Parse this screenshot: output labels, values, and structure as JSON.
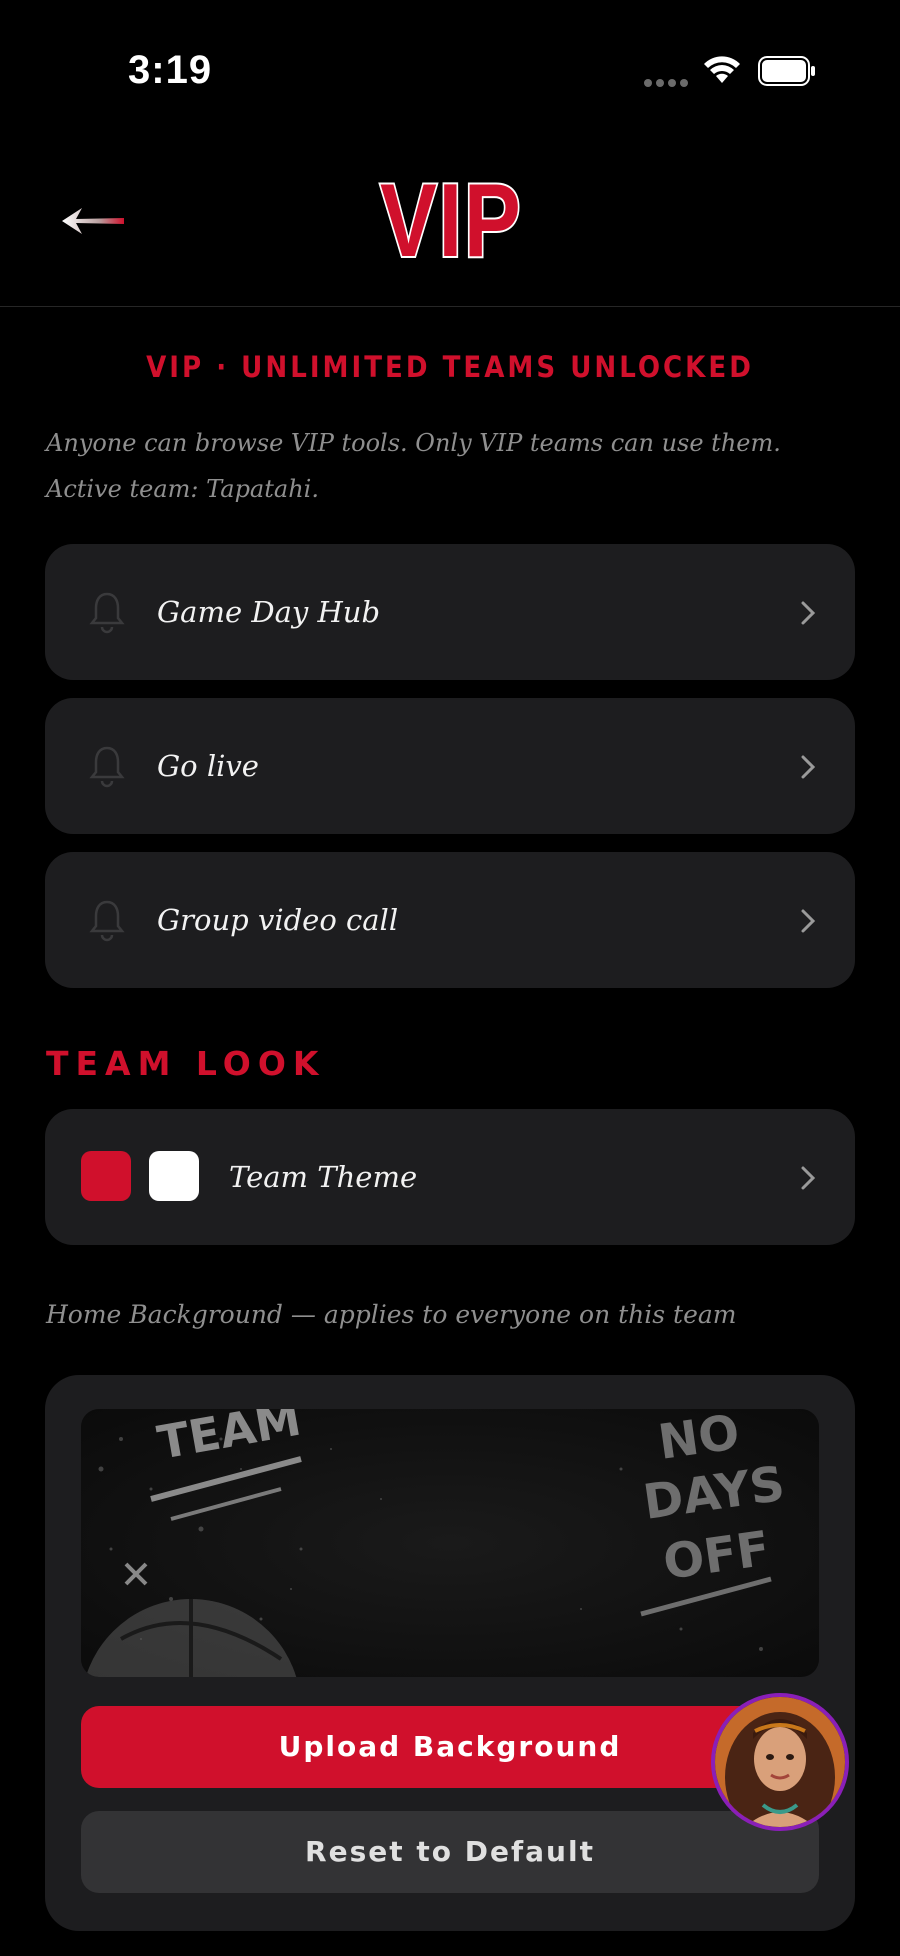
{
  "status_bar": {
    "time": "3:19"
  },
  "header": {
    "title": "VIP"
  },
  "vip_status": "VIP · UNLIMITED TEAMS UNLOCKED",
  "intro_text": "Anyone can browse VIP tools. Only VIP teams can use them. Active team: Tapatahi.",
  "tools": [
    {
      "label": "Game Day Hub",
      "icon": "bell-icon"
    },
    {
      "label": "Go live",
      "icon": "bell-icon"
    },
    {
      "label": "Group video call",
      "icon": "bell-icon"
    }
  ],
  "team_look": {
    "section_title": "TEAM LOOK",
    "theme_label": "Team Theme",
    "primary_color": "#d0102c",
    "secondary_color": "#ffffff"
  },
  "background": {
    "label": "Home Background — applies to everyone on this team",
    "preview_text_left": "TEAM",
    "preview_text_right": [
      "NO",
      "DAYS",
      "OFF"
    ],
    "upload_label": "Upload Background",
    "reset_label": "Reset to Default"
  },
  "colors": {
    "accent": "#d0102c",
    "card": "#1d1d1f",
    "background": "#000000"
  }
}
